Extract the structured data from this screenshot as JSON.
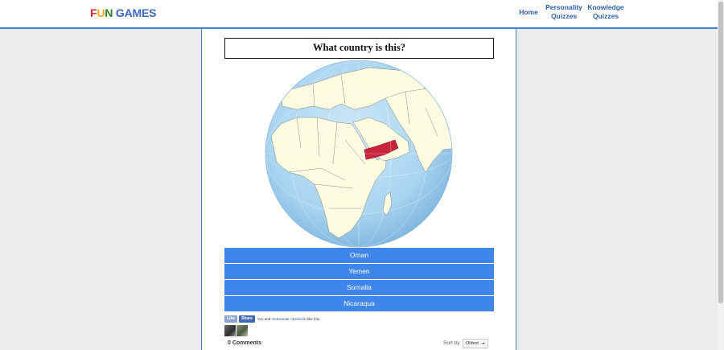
{
  "header": {
    "logo": {
      "fun": "FUN",
      "games": "GAMES"
    },
    "nav": [
      {
        "label": "Home"
      },
      {
        "label": "Personality Quizzes"
      },
      {
        "label": "Knowledge Quizzes"
      }
    ]
  },
  "quiz": {
    "question": "What country is this?",
    "answers": [
      {
        "label": "Oman"
      },
      {
        "label": "Yemen"
      },
      {
        "label": "Somalia"
      },
      {
        "label": "Nicaraqua"
      }
    ],
    "highlight_color": "#c9253c"
  },
  "social": {
    "like_label": "Like",
    "share_label": "Share",
    "text_prefix": "You and ",
    "friend_name": "Aleksandar Vasilevski",
    "text_suffix": " like this."
  },
  "comments": {
    "count_label": "0 Comments",
    "sort_label": "Sort by",
    "sort_value": "Oldest"
  },
  "colors": {
    "accent": "#3e86ea",
    "nav": "#2b5fae",
    "ocean": "#a8d4ef",
    "land": "#fdfbe0"
  }
}
